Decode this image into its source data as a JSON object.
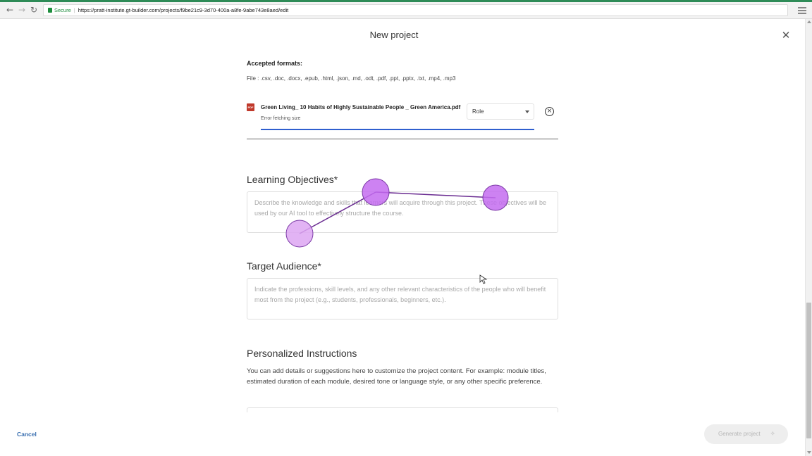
{
  "browser": {
    "secure_label": "Secure",
    "url": "https://pratt-institute.gt-builder.com/projects/f9be21c9-3d70-400a-a8fe-9abe743e8aed/edit"
  },
  "modal": {
    "title": "New project"
  },
  "upload": {
    "formats_title": "Accepted formats:",
    "formats_list": "File : .csv, .doc, .docx, .epub, .html, .json, .md, .odt, .pdf, .ppt, .pptx, .txt, .mp4, .mp3",
    "file": {
      "icon_label": "PDF",
      "name": "Green Living_ 10 Habits of Highly Sustainable People _ Green America.pdf",
      "status": "Error fetching size",
      "role_selected": "Role",
      "progress_fraction": 1.0
    }
  },
  "learning_objectives": {
    "title": "Learning Objectives*",
    "placeholder": "Describe the knowledge and skills that learners will acquire through this project. These objectives will be used by our AI tool to effectively structure the course."
  },
  "target_audience": {
    "title": "Target Audience*",
    "placeholder": "Indicate the professions, skill levels, and any other relevant characteristics of the people who will benefit most from the project (e.g., students, professionals, beginners, etc.)."
  },
  "personalized_instructions": {
    "title": "Personalized Instructions",
    "help": "You can add details or suggestions here to customize the project content. For example: module titles, estimated duration of each module, desired tone or language style, or any other specific preference."
  },
  "footer": {
    "cancel_label": "Cancel",
    "generate_label": "Generate project"
  },
  "colors": {
    "accent": "#2f5fcf",
    "link": "#3a6fb0",
    "overlay_marker": "#c46cf0",
    "pdf_icon": "#c0392b"
  }
}
